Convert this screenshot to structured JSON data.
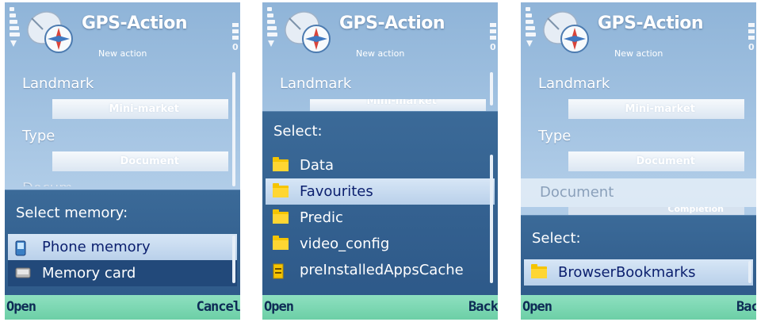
{
  "app": {
    "title": "GPS-Action",
    "subtitle": "New action"
  },
  "form": {
    "landmark_label": "Landmark",
    "landmark_value": "Mini-market",
    "type_label": "Type",
    "type_value": "Document",
    "document_label": "Document",
    "document_value": "Completion",
    "document_peek": "Docum"
  },
  "screen1": {
    "popup_title": "Select memory:",
    "items": [
      {
        "label": "Phone memory",
        "icon": "phone-icon",
        "selected": true
      },
      {
        "label": "Memory card",
        "icon": "memory-card-icon",
        "selected": false
      }
    ],
    "softkey_left": "Open",
    "softkey_right": "Cancel"
  },
  "screen2": {
    "popup_title": "Select:",
    "items": [
      {
        "label": "Data",
        "icon": "folder-icon",
        "selected": false
      },
      {
        "label": "Favourites",
        "icon": "folder-icon",
        "selected": true
      },
      {
        "label": "Predic",
        "icon": "folder-icon",
        "selected": false
      },
      {
        "label": "video_config",
        "icon": "folder-icon",
        "selected": false
      },
      {
        "label": "preInstalledAppsCache",
        "icon": "file-icon",
        "selected": false
      }
    ],
    "softkey_left": "Open",
    "softkey_right": "Back"
  },
  "screen3": {
    "popup_title": "Select:",
    "items": [
      {
        "label": "BrowserBookmarks",
        "icon": "folder-icon",
        "selected": true
      }
    ],
    "softkey_left": "Open",
    "softkey_right": "Back"
  },
  "colors": {
    "highlight": "#c9dbef",
    "popup": "#2f5b8b",
    "softkey_bar": "#7dd8b4"
  }
}
